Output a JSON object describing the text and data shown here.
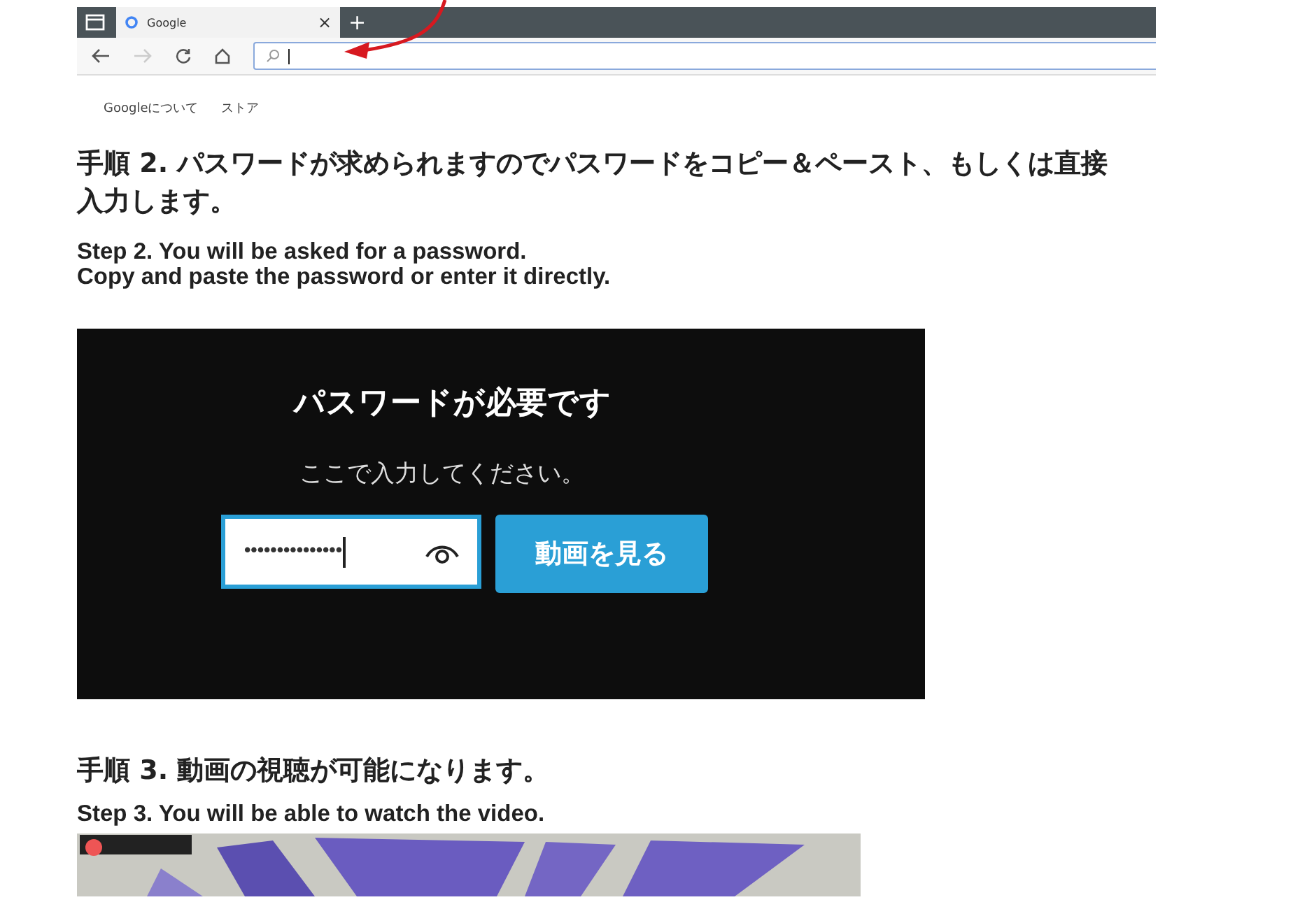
{
  "browser": {
    "tab_title": "Google",
    "tab_close": "×",
    "new_tab": "+",
    "links": [
      "Googleについて",
      "ストア"
    ]
  },
  "step2": {
    "heading_ja": "手順 2. パスワードが求められますのでパスワードをコピー＆ペースト、もしくは直接入力します。",
    "heading_en_1": "Step 2. You will be asked for a password.",
    "heading_en_2": "Copy and paste the password or enter it directly."
  },
  "password_dialog": {
    "title": "パスワードが必要です",
    "prompt": "ここで入力してください。",
    "password_value": "•••••••••••••••",
    "button": "動画を見る"
  },
  "step3": {
    "heading_ja": "手順 3. 動画の視聴が可能になります。",
    "heading_en": "Step 3. You will be able to watch the video."
  }
}
